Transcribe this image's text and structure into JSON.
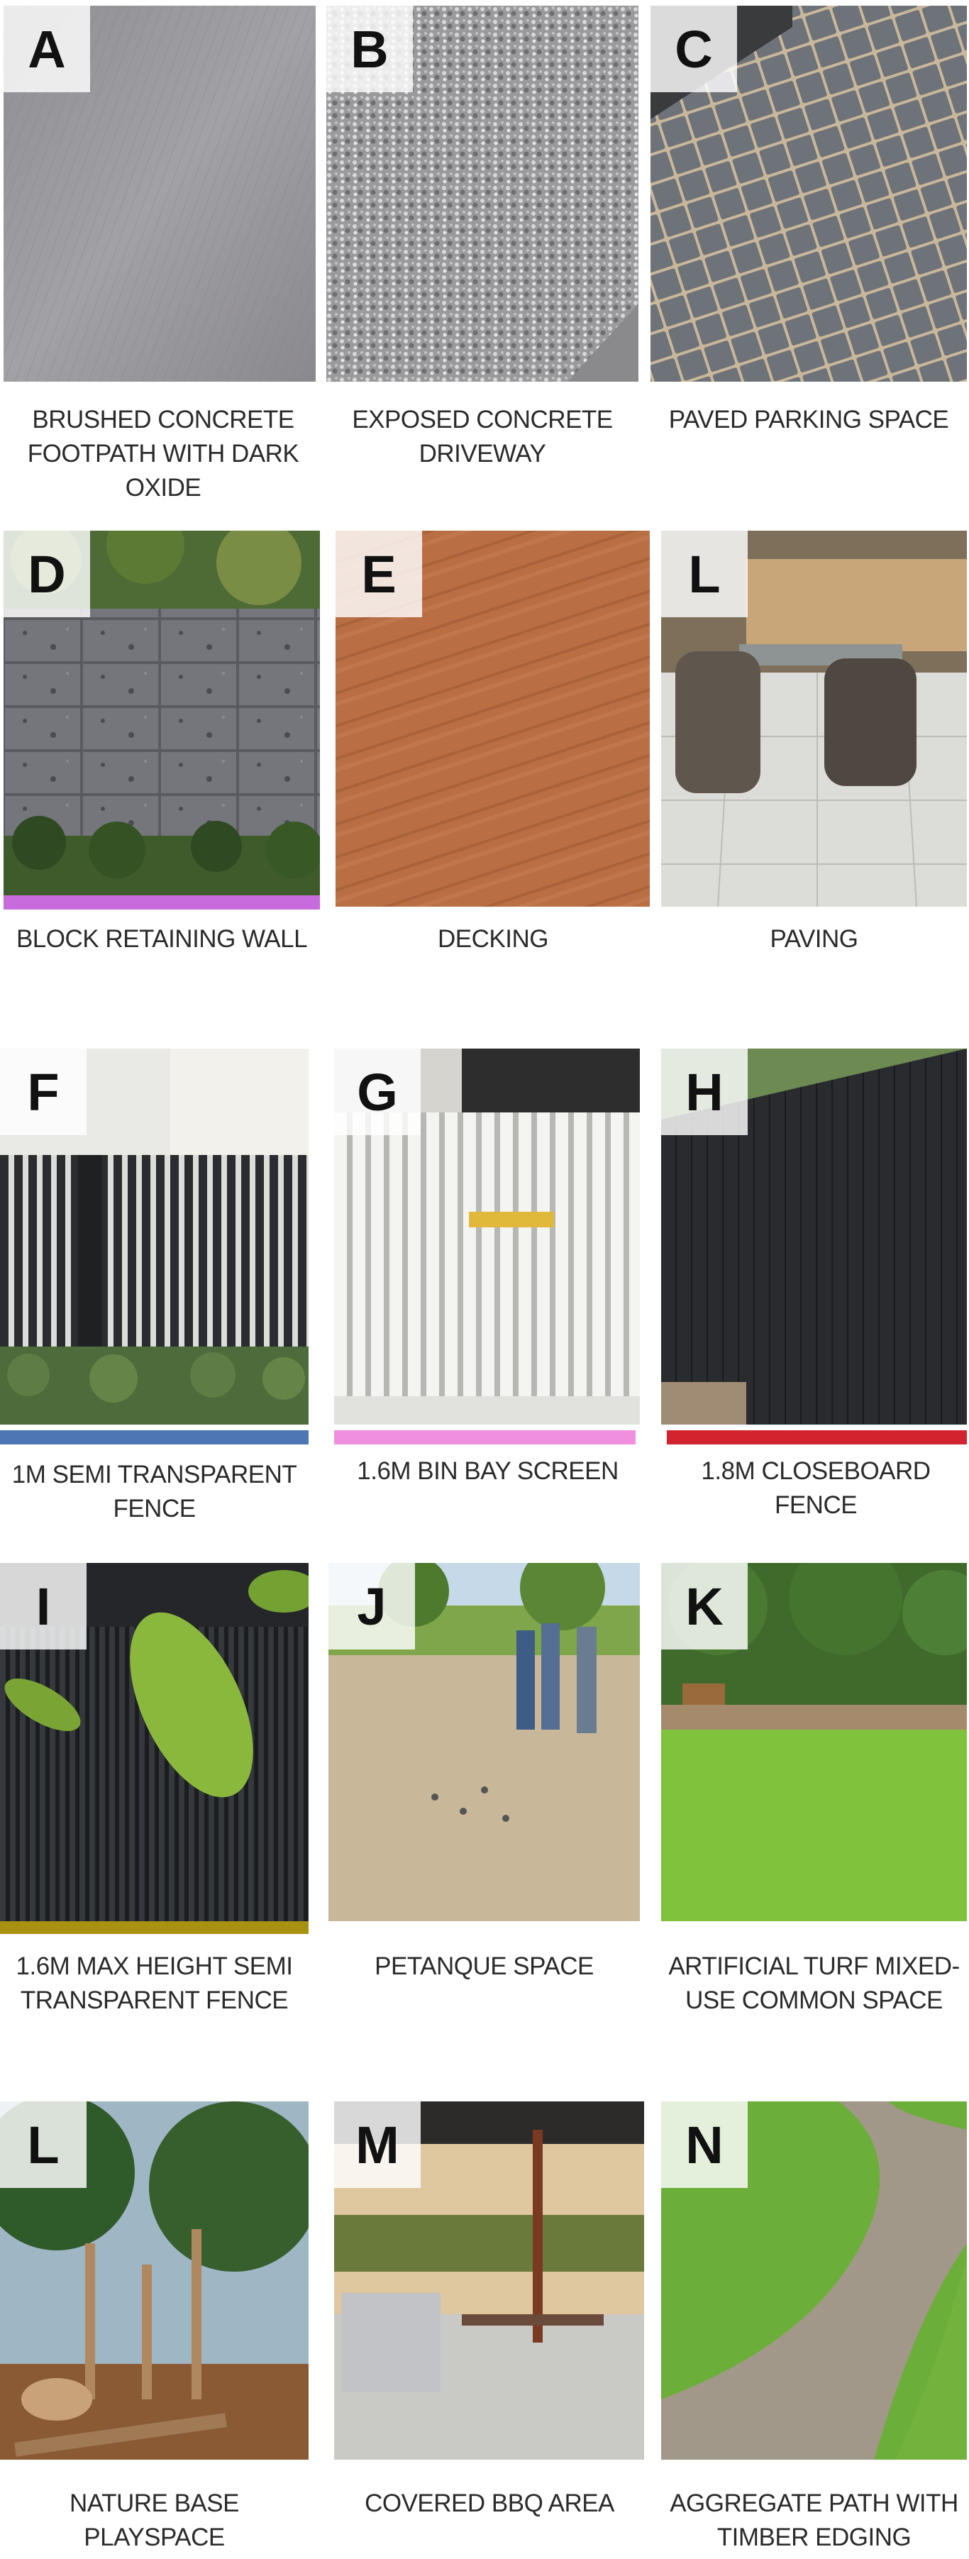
{
  "colors": {
    "purple_bar": "#c86bdc",
    "blue_bar": "#4e75b4",
    "pink_bar": "#f08ee0",
    "red_bar": "#d2232e",
    "olive_bar": "#a99112"
  },
  "tiles": [
    {
      "letter": "A",
      "caption": "BRUSHED CONCRETE FOOTPATH WITH DARK OXIDE",
      "image": "brushed-concrete"
    },
    {
      "letter": "B",
      "caption": "EXPOSED CONCRETE DRIVEWAY",
      "image": "exposed-aggregate"
    },
    {
      "letter": "C",
      "caption": "PAVED PARKING SPACE",
      "image": "grey-pavers"
    },
    {
      "letter": "D",
      "caption": "BLOCK RETAINING WALL",
      "image": "block-wall"
    },
    {
      "letter": "E",
      "caption": "DECKING",
      "image": "timber-decking"
    },
    {
      "letter": "L",
      "caption": "PAVING",
      "image": "patio-paving"
    },
    {
      "letter": "F",
      "caption": "1M SEMI TRANSPARENT FENCE",
      "image": "slat-fence-black"
    },
    {
      "letter": "G",
      "caption": "1.6M BIN BAY SCREEN",
      "image": "white-bin-screen"
    },
    {
      "letter": "H",
      "caption": "1.8M CLOSEBOARD FENCE",
      "image": "closeboard-fence"
    },
    {
      "letter": "I",
      "caption": "1.6M MAX HEIGHT SEMI TRANSPARENT FENCE",
      "image": "tall-slat-fence"
    },
    {
      "letter": "J",
      "caption": "PETANQUE SPACE",
      "image": "petanque-court"
    },
    {
      "letter": "K",
      "caption": "ARTIFICIAL TURF MIXED-USE COMMON SPACE",
      "image": "artificial-turf"
    },
    {
      "letter": "L",
      "caption": "NATURE BASE PLAYSPACE",
      "image": "nature-play"
    },
    {
      "letter": "M",
      "caption": "COVERED BBQ AREA",
      "image": "bbq-pavilion"
    },
    {
      "letter": "N",
      "caption": "AGGREGATE PATH WITH TIMBER EDGING",
      "image": "aggregate-path"
    }
  ]
}
